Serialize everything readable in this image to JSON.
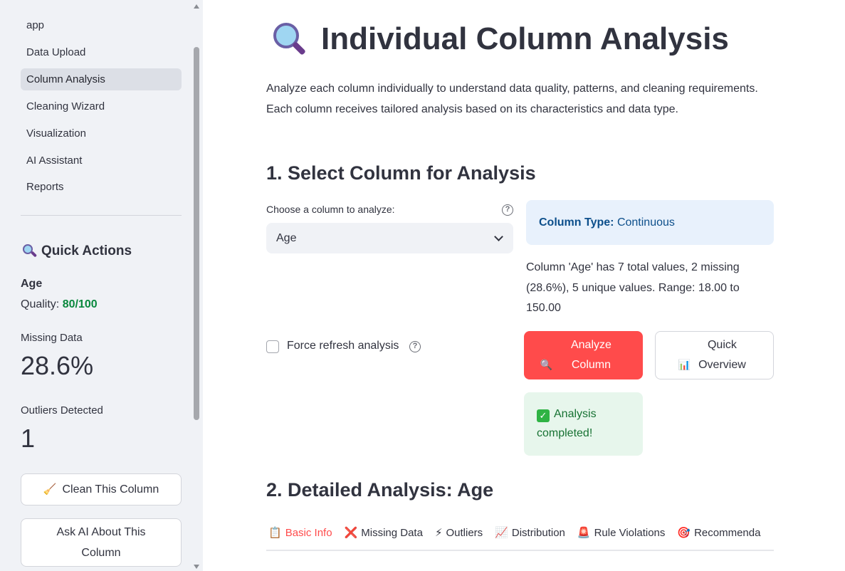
{
  "sidebar": {
    "nav": [
      {
        "label": "app",
        "active": false
      },
      {
        "label": "Data Upload",
        "active": false
      },
      {
        "label": "Column Analysis",
        "active": true
      },
      {
        "label": "Cleaning Wizard",
        "active": false
      },
      {
        "label": "Visualization",
        "active": false
      },
      {
        "label": "AI Assistant",
        "active": false
      },
      {
        "label": "Reports",
        "active": false
      }
    ],
    "quick_actions": {
      "title": "Quick Actions",
      "icon": "magnifier-icon",
      "column_name": "Age",
      "quality_label": "Quality:",
      "quality_value": "80/100",
      "missing_label": "Missing Data",
      "missing_value": "28.6%",
      "outliers_label": "Outliers Detected",
      "outliers_value": "1",
      "clean_button": "Clean This Column",
      "ask_ai_button": "Ask AI About This Column"
    }
  },
  "main": {
    "title": "Individual Column Analysis",
    "intro": "Analyze each column individually to understand data quality, patterns, and cleaning requirements. Each column receives tailored analysis based on its characteristics and data type.",
    "section1_title": "1. Select Column for Analysis",
    "select_label": "Choose a column to analyze:",
    "select_value": "Age",
    "column_type_key": "Column Type:",
    "column_type_value": "Continuous",
    "summary": "Column 'Age' has 7 total values, 2 missing (28.6%), 5 unique values. Range: 18.00 to 150.00",
    "force_refresh_label": "Force refresh analysis",
    "analyze_button": "Analyze Column",
    "quick_overview_button": "Quick Overview",
    "success_message": "Analysis completed!",
    "section2_title": "2. Detailed Analysis: Age",
    "tabs": [
      {
        "label": "Basic Info",
        "icon": "📋",
        "active": true
      },
      {
        "label": "Missing Data",
        "icon": "❌",
        "active": false
      },
      {
        "label": "Outliers",
        "icon": "⚡",
        "active": false
      },
      {
        "label": "Distribution",
        "icon": "📈",
        "active": false
      },
      {
        "label": "Rule Violations",
        "icon": "🚨",
        "active": false
      },
      {
        "label": "Recommenda",
        "icon": "🎯",
        "active": false
      }
    ]
  },
  "colors": {
    "primary": "#ff4b4b",
    "sidebar_bg": "#f0f2f6",
    "success_text": "#177233",
    "quality_green": "#09883d",
    "info_text": "#0d4f8b"
  }
}
